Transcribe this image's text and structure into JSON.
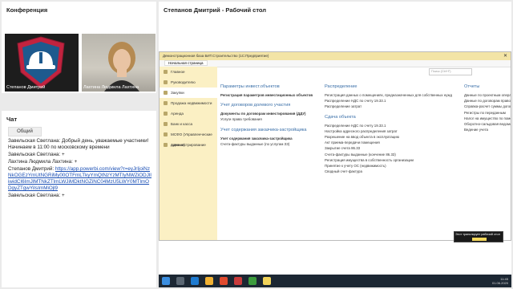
{
  "conference": {
    "title": "Конференция",
    "participants": [
      {
        "name": "Степанов Дмитрий"
      },
      {
        "name": "Лахтина Людмила Лахтина"
      }
    ]
  },
  "chat": {
    "title": "Чат",
    "tab": "Общий",
    "messages": [
      {
        "text": "Завельская Светлана: Добрый день, уважаемые участники! Начинаем в 11:00 по московскому времени"
      },
      {
        "text": "Завельская Светлана: +"
      },
      {
        "text": "Лахтина Людмила Лахтина: +"
      },
      {
        "author": "Степанов Дмитрий: ",
        "link": "https://app.powerbi.com/view?r=eyJrIjoiNzNkOGEzYmUtNGRiMy00OTFmLTkyYmQtNzYzMTIyNWZiODJlIiwidCI6ImJlMTNkZTlmLWJiMDktNGZiNC04MzU5LWY0MTlmODgyZTgwYiIsImMiOjl9"
      },
      {
        "text": "Завельская Светлана: +"
      }
    ]
  },
  "desktop": {
    "title": "Степанов Дмитрий - Рабочий стол",
    "window_title": "Демонстрационная база БИТ.Строительство (1С:Предприятие)",
    "tab": "Начальная страница",
    "search_placeholder": "Поиск (Ctrl+F)",
    "sidebar": [
      {
        "label": "Главное"
      },
      {
        "label": "Руководителю"
      },
      {
        "label": "Закупки"
      },
      {
        "label": "Продажа недвижимости"
      },
      {
        "label": "Аренда"
      },
      {
        "label": "Банк и касса"
      },
      {
        "label": "МСФО (Управленческие данные)"
      },
      {
        "label": "Администрирование"
      }
    ],
    "col1": {
      "h1": "Параметры инвест.объектов",
      "i1": "Регистрация параметров инвестиционных объектов",
      "h2": "Учет договоров долевого участия",
      "i2": "Документы по договорам инвестирования (ДДУ)",
      "i3": "Услуги права требования",
      "h3": "Учет содержания заказчика-застройщика",
      "i4": "Учет содержания заказчика-застройщика",
      "i5": "Счета-фактуры выданные (по услугам ЗЗ)"
    },
    "col2": {
      "h1": "Распределение",
      "items1": [
        "Регистрация данных о помещениях, предназначенных для собственных нужд",
        "Распределение НДС по счету 19.33.1",
        "Распределение затрат"
      ],
      "h2": "Сдача объекта",
      "items2": [
        "Распределение НДС по счету 19.33.1",
        "Настройка адресного распределения затрат",
        "Разрешение на ввод объекта в эксплуатацию",
        "Акт приема-передачи помещения",
        "Закрытие счета 86.33",
        "Счета-фактуры выданные (кончение 86.33)",
        "Регистрация имущества в собственность организации",
        "Принятие к учету ОС (недвижимость)",
        "Сводный счет-фактура"
      ]
    },
    "col3": {
      "h1": "Отчеты",
      "items": [
        "Данные по проектным операциям",
        "Данные по договорам право требования",
        "Справка-расчет суммы договора",
        "Регистры по переданным",
        "Налог на имущество по помещениям",
        "Оборотно-сальдовая ведомость",
        "Ведение учета"
      ]
    },
    "tooltip": "Этот транслирует рабочий стол",
    "tray_time": "11:45",
    "tray_date": "01.06.2020"
  }
}
